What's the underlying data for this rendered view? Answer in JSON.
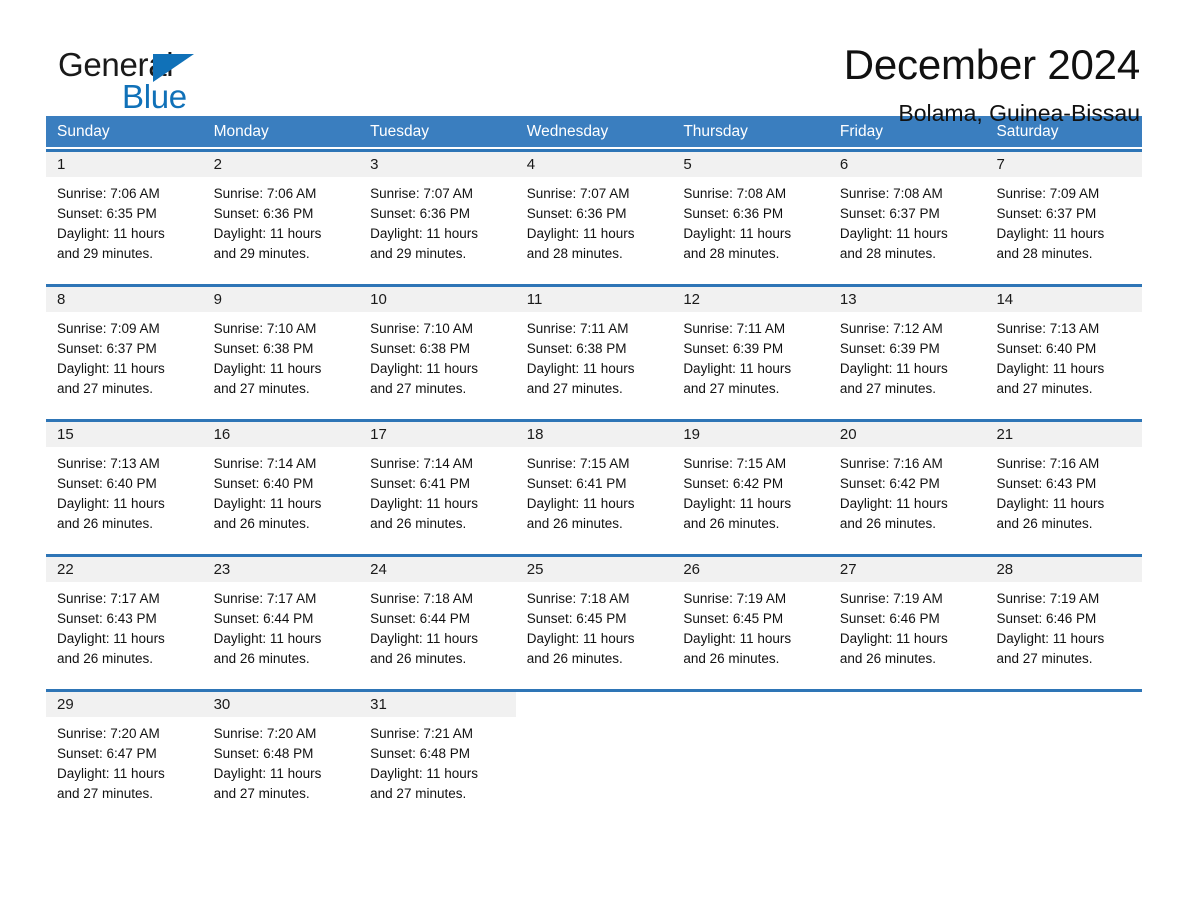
{
  "brand": {
    "word_general": "General",
    "word_blue": "Blue",
    "triangle_color": "#1071b8"
  },
  "header": {
    "title": "December 2024",
    "subtitle": "Bolama, Guinea-Bissau"
  },
  "theme": {
    "header_blue": "#3a7ebf",
    "row_rule_blue": "#2e75b6",
    "daynum_band": "#f1f1f1",
    "text": "#111111"
  },
  "weekday_headers": [
    "Sunday",
    "Monday",
    "Tuesday",
    "Wednesday",
    "Thursday",
    "Friday",
    "Saturday"
  ],
  "labels": {
    "sunrise_prefix": "Sunrise:",
    "sunset_prefix": "Sunset:",
    "daylight_prefix": "Daylight:"
  },
  "weeks": [
    [
      {
        "day": "1",
        "sunrise": "Sunrise: 7:06 AM",
        "sunset": "Sunset: 6:35 PM",
        "daylight_line1": "Daylight: 11 hours",
        "daylight_line2": "and 29 minutes."
      },
      {
        "day": "2",
        "sunrise": "Sunrise: 7:06 AM",
        "sunset": "Sunset: 6:36 PM",
        "daylight_line1": "Daylight: 11 hours",
        "daylight_line2": "and 29 minutes."
      },
      {
        "day": "3",
        "sunrise": "Sunrise: 7:07 AM",
        "sunset": "Sunset: 6:36 PM",
        "daylight_line1": "Daylight: 11 hours",
        "daylight_line2": "and 29 minutes."
      },
      {
        "day": "4",
        "sunrise": "Sunrise: 7:07 AM",
        "sunset": "Sunset: 6:36 PM",
        "daylight_line1": "Daylight: 11 hours",
        "daylight_line2": "and 28 minutes."
      },
      {
        "day": "5",
        "sunrise": "Sunrise: 7:08 AM",
        "sunset": "Sunset: 6:36 PM",
        "daylight_line1": "Daylight: 11 hours",
        "daylight_line2": "and 28 minutes."
      },
      {
        "day": "6",
        "sunrise": "Sunrise: 7:08 AM",
        "sunset": "Sunset: 6:37 PM",
        "daylight_line1": "Daylight: 11 hours",
        "daylight_line2": "and 28 minutes."
      },
      {
        "day": "7",
        "sunrise": "Sunrise: 7:09 AM",
        "sunset": "Sunset: 6:37 PM",
        "daylight_line1": "Daylight: 11 hours",
        "daylight_line2": "and 28 minutes."
      }
    ],
    [
      {
        "day": "8",
        "sunrise": "Sunrise: 7:09 AM",
        "sunset": "Sunset: 6:37 PM",
        "daylight_line1": "Daylight: 11 hours",
        "daylight_line2": "and 27 minutes."
      },
      {
        "day": "9",
        "sunrise": "Sunrise: 7:10 AM",
        "sunset": "Sunset: 6:38 PM",
        "daylight_line1": "Daylight: 11 hours",
        "daylight_line2": "and 27 minutes."
      },
      {
        "day": "10",
        "sunrise": "Sunrise: 7:10 AM",
        "sunset": "Sunset: 6:38 PM",
        "daylight_line1": "Daylight: 11 hours",
        "daylight_line2": "and 27 minutes."
      },
      {
        "day": "11",
        "sunrise": "Sunrise: 7:11 AM",
        "sunset": "Sunset: 6:38 PM",
        "daylight_line1": "Daylight: 11 hours",
        "daylight_line2": "and 27 minutes."
      },
      {
        "day": "12",
        "sunrise": "Sunrise: 7:11 AM",
        "sunset": "Sunset: 6:39 PM",
        "daylight_line1": "Daylight: 11 hours",
        "daylight_line2": "and 27 minutes."
      },
      {
        "day": "13",
        "sunrise": "Sunrise: 7:12 AM",
        "sunset": "Sunset: 6:39 PM",
        "daylight_line1": "Daylight: 11 hours",
        "daylight_line2": "and 27 minutes."
      },
      {
        "day": "14",
        "sunrise": "Sunrise: 7:13 AM",
        "sunset": "Sunset: 6:40 PM",
        "daylight_line1": "Daylight: 11 hours",
        "daylight_line2": "and 27 minutes."
      }
    ],
    [
      {
        "day": "15",
        "sunrise": "Sunrise: 7:13 AM",
        "sunset": "Sunset: 6:40 PM",
        "daylight_line1": "Daylight: 11 hours",
        "daylight_line2": "and 26 minutes."
      },
      {
        "day": "16",
        "sunrise": "Sunrise: 7:14 AM",
        "sunset": "Sunset: 6:40 PM",
        "daylight_line1": "Daylight: 11 hours",
        "daylight_line2": "and 26 minutes."
      },
      {
        "day": "17",
        "sunrise": "Sunrise: 7:14 AM",
        "sunset": "Sunset: 6:41 PM",
        "daylight_line1": "Daylight: 11 hours",
        "daylight_line2": "and 26 minutes."
      },
      {
        "day": "18",
        "sunrise": "Sunrise: 7:15 AM",
        "sunset": "Sunset: 6:41 PM",
        "daylight_line1": "Daylight: 11 hours",
        "daylight_line2": "and 26 minutes."
      },
      {
        "day": "19",
        "sunrise": "Sunrise: 7:15 AM",
        "sunset": "Sunset: 6:42 PM",
        "daylight_line1": "Daylight: 11 hours",
        "daylight_line2": "and 26 minutes."
      },
      {
        "day": "20",
        "sunrise": "Sunrise: 7:16 AM",
        "sunset": "Sunset: 6:42 PM",
        "daylight_line1": "Daylight: 11 hours",
        "daylight_line2": "and 26 minutes."
      },
      {
        "day": "21",
        "sunrise": "Sunrise: 7:16 AM",
        "sunset": "Sunset: 6:43 PM",
        "daylight_line1": "Daylight: 11 hours",
        "daylight_line2": "and 26 minutes."
      }
    ],
    [
      {
        "day": "22",
        "sunrise": "Sunrise: 7:17 AM",
        "sunset": "Sunset: 6:43 PM",
        "daylight_line1": "Daylight: 11 hours",
        "daylight_line2": "and 26 minutes."
      },
      {
        "day": "23",
        "sunrise": "Sunrise: 7:17 AM",
        "sunset": "Sunset: 6:44 PM",
        "daylight_line1": "Daylight: 11 hours",
        "daylight_line2": "and 26 minutes."
      },
      {
        "day": "24",
        "sunrise": "Sunrise: 7:18 AM",
        "sunset": "Sunset: 6:44 PM",
        "daylight_line1": "Daylight: 11 hours",
        "daylight_line2": "and 26 minutes."
      },
      {
        "day": "25",
        "sunrise": "Sunrise: 7:18 AM",
        "sunset": "Sunset: 6:45 PM",
        "daylight_line1": "Daylight: 11 hours",
        "daylight_line2": "and 26 minutes."
      },
      {
        "day": "26",
        "sunrise": "Sunrise: 7:19 AM",
        "sunset": "Sunset: 6:45 PM",
        "daylight_line1": "Daylight: 11 hours",
        "daylight_line2": "and 26 minutes."
      },
      {
        "day": "27",
        "sunrise": "Sunrise: 7:19 AM",
        "sunset": "Sunset: 6:46 PM",
        "daylight_line1": "Daylight: 11 hours",
        "daylight_line2": "and 26 minutes."
      },
      {
        "day": "28",
        "sunrise": "Sunrise: 7:19 AM",
        "sunset": "Sunset: 6:46 PM",
        "daylight_line1": "Daylight: 11 hours",
        "daylight_line2": "and 27 minutes."
      }
    ],
    [
      {
        "day": "29",
        "sunrise": "Sunrise: 7:20 AM",
        "sunset": "Sunset: 6:47 PM",
        "daylight_line1": "Daylight: 11 hours",
        "daylight_line2": "and 27 minutes."
      },
      {
        "day": "30",
        "sunrise": "Sunrise: 7:20 AM",
        "sunset": "Sunset: 6:48 PM",
        "daylight_line1": "Daylight: 11 hours",
        "daylight_line2": "and 27 minutes."
      },
      {
        "day": "31",
        "sunrise": "Sunrise: 7:21 AM",
        "sunset": "Sunset: 6:48 PM",
        "daylight_line1": "Daylight: 11 hours",
        "daylight_line2": "and 27 minutes."
      },
      {
        "day": "",
        "sunrise": "",
        "sunset": "",
        "daylight_line1": "",
        "daylight_line2": ""
      },
      {
        "day": "",
        "sunrise": "",
        "sunset": "",
        "daylight_line1": "",
        "daylight_line2": ""
      },
      {
        "day": "",
        "sunrise": "",
        "sunset": "",
        "daylight_line1": "",
        "daylight_line2": ""
      },
      {
        "day": "",
        "sunrise": "",
        "sunset": "",
        "daylight_line1": "",
        "daylight_line2": ""
      }
    ]
  ]
}
